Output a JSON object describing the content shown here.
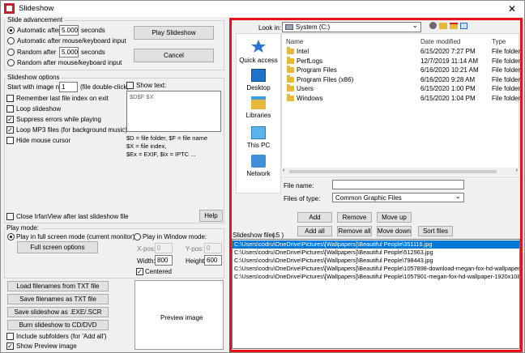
{
  "window": {
    "title": "Slideshow",
    "close_glyph": "✕"
  },
  "advancement": {
    "legend": "Slide advancement",
    "automatic_after": "Automatic after",
    "automatic_value": "5.000",
    "seconds": "seconds",
    "auto_mouse": "Automatic after mouse/keyboard input",
    "random_after": "Random   after",
    "random_value": "5.000",
    "random_mouse": "Random   after mouse/keyboard input"
  },
  "buttons": {
    "play": "Play Slideshow",
    "cancel": "Cancel",
    "help": "Help"
  },
  "options": {
    "legend": "Slideshow options",
    "start_with_label": "Start with image nr.:",
    "start_with_value": "1",
    "start_hint": "(file double-click)",
    "remember": "Remember last file index on exit",
    "loop": "Loop slideshow",
    "suppress": "Suppress errors while playing",
    "loop_mp3": "Loop MP3 files (for background music)",
    "hide_cursor": "Hide mouse cursor",
    "show_text": "Show text:",
    "text_value": "$D$F $X",
    "hint_lines": [
      "$D = file folder, $F = file name",
      "$X = file index,",
      "$Ex = EXIF, $Ix = IPTC ..."
    ],
    "close_after": "Close IrfanView after last slideshow file"
  },
  "play_mode": {
    "legend": "Play mode:",
    "fullscreen": "Play in full screen mode (current monitor)",
    "fullscreen_options": "Full screen options",
    "window_mode": "Play in Window mode:",
    "xpos_label": "X-pos:",
    "xpos_value": "0",
    "ypos_label": "Y-pos:",
    "ypos_value": "0",
    "width_label": "Width:",
    "width_value": "800",
    "height_label": "Height:",
    "height_value": "600",
    "centered": "Centered"
  },
  "bottom_buttons": {
    "load_txt": "Load filenames from TXT file",
    "save_txt": "Save filenames as TXT file",
    "save_exe": "Save slideshow as .EXE/.SCR",
    "burn": "Burn slideshow to CD/DVD",
    "include_sub": "Include subfolders (for 'Add all')",
    "show_preview": "Show Preview image",
    "preview_label": "Preview image"
  },
  "browser": {
    "look_in_label": "Look in:",
    "look_in_value": "System (C:)",
    "places": [
      {
        "label": "Quick access",
        "icon": "star-icon"
      },
      {
        "label": "Desktop",
        "icon": "desktop-icon"
      },
      {
        "label": "Libraries",
        "icon": "libraries-icon"
      },
      {
        "label": "This PC",
        "icon": "computer-icon"
      },
      {
        "label": "Network",
        "icon": "network-icon"
      }
    ],
    "columns": {
      "name": "Name",
      "date": "Date modified",
      "type": "Type"
    },
    "files": [
      {
        "name": "Intel",
        "date": "6/15/2020 7:27 PM",
        "type": "File folder"
      },
      {
        "name": "PerfLogs",
        "date": "12/7/2019 11:14 AM",
        "type": "File folder"
      },
      {
        "name": "Program Files",
        "date": "6/16/2020 10:21 AM",
        "type": "File folder"
      },
      {
        "name": "Program Files (x86)",
        "date": "6/16/2020 9:28 AM",
        "type": "File folder"
      },
      {
        "name": "Users",
        "date": "6/15/2020 1:00 PM",
        "type": "File folder"
      },
      {
        "name": "Windows",
        "date": "6/15/2020 1:04 PM",
        "type": "File folder"
      }
    ],
    "file_name_label": "File name:",
    "file_name_value": "",
    "files_of_type_label": "Files of type:",
    "files_of_type_value": "Common Graphic Files",
    "add": "Add",
    "remove": "Remove",
    "move_up": "Move up",
    "add_all": "Add all",
    "remove_all": "Remove all",
    "move_down": "Move down",
    "sort_files": "Sort files",
    "slideshow_files_label": "Slideshow files:",
    "slideshow_files_count": "( 5 )",
    "slideshow_files": [
      "C:\\Users\\codru\\OneDrive\\Pictures\\[Wallpapers]\\Beautiful People\\351116.jpg",
      "C:\\Users\\codru\\OneDrive\\Pictures\\[Wallpapers]\\Beautiful People\\512963.jpg",
      "C:\\Users\\codru\\OneDrive\\Pictures\\[Wallpapers]\\Beautiful People\\798443.jpg",
      "C:\\Users\\codru\\OneDrive\\Pictures\\[Wallpapers]\\Beautiful People\\1057898-download-megan-fox-hd-wallpaper-1920x1200-p",
      "C:\\Users\\codru\\OneDrive\\Pictures\\[Wallpapers]\\Beautiful People\\1057901-megan-fox-hd-wallpaper-1920x1080-photo.jpg"
    ]
  },
  "colors": {
    "highlight": "#e8101a",
    "selection": "#0078d7",
    "folder": "#e8b83a"
  }
}
